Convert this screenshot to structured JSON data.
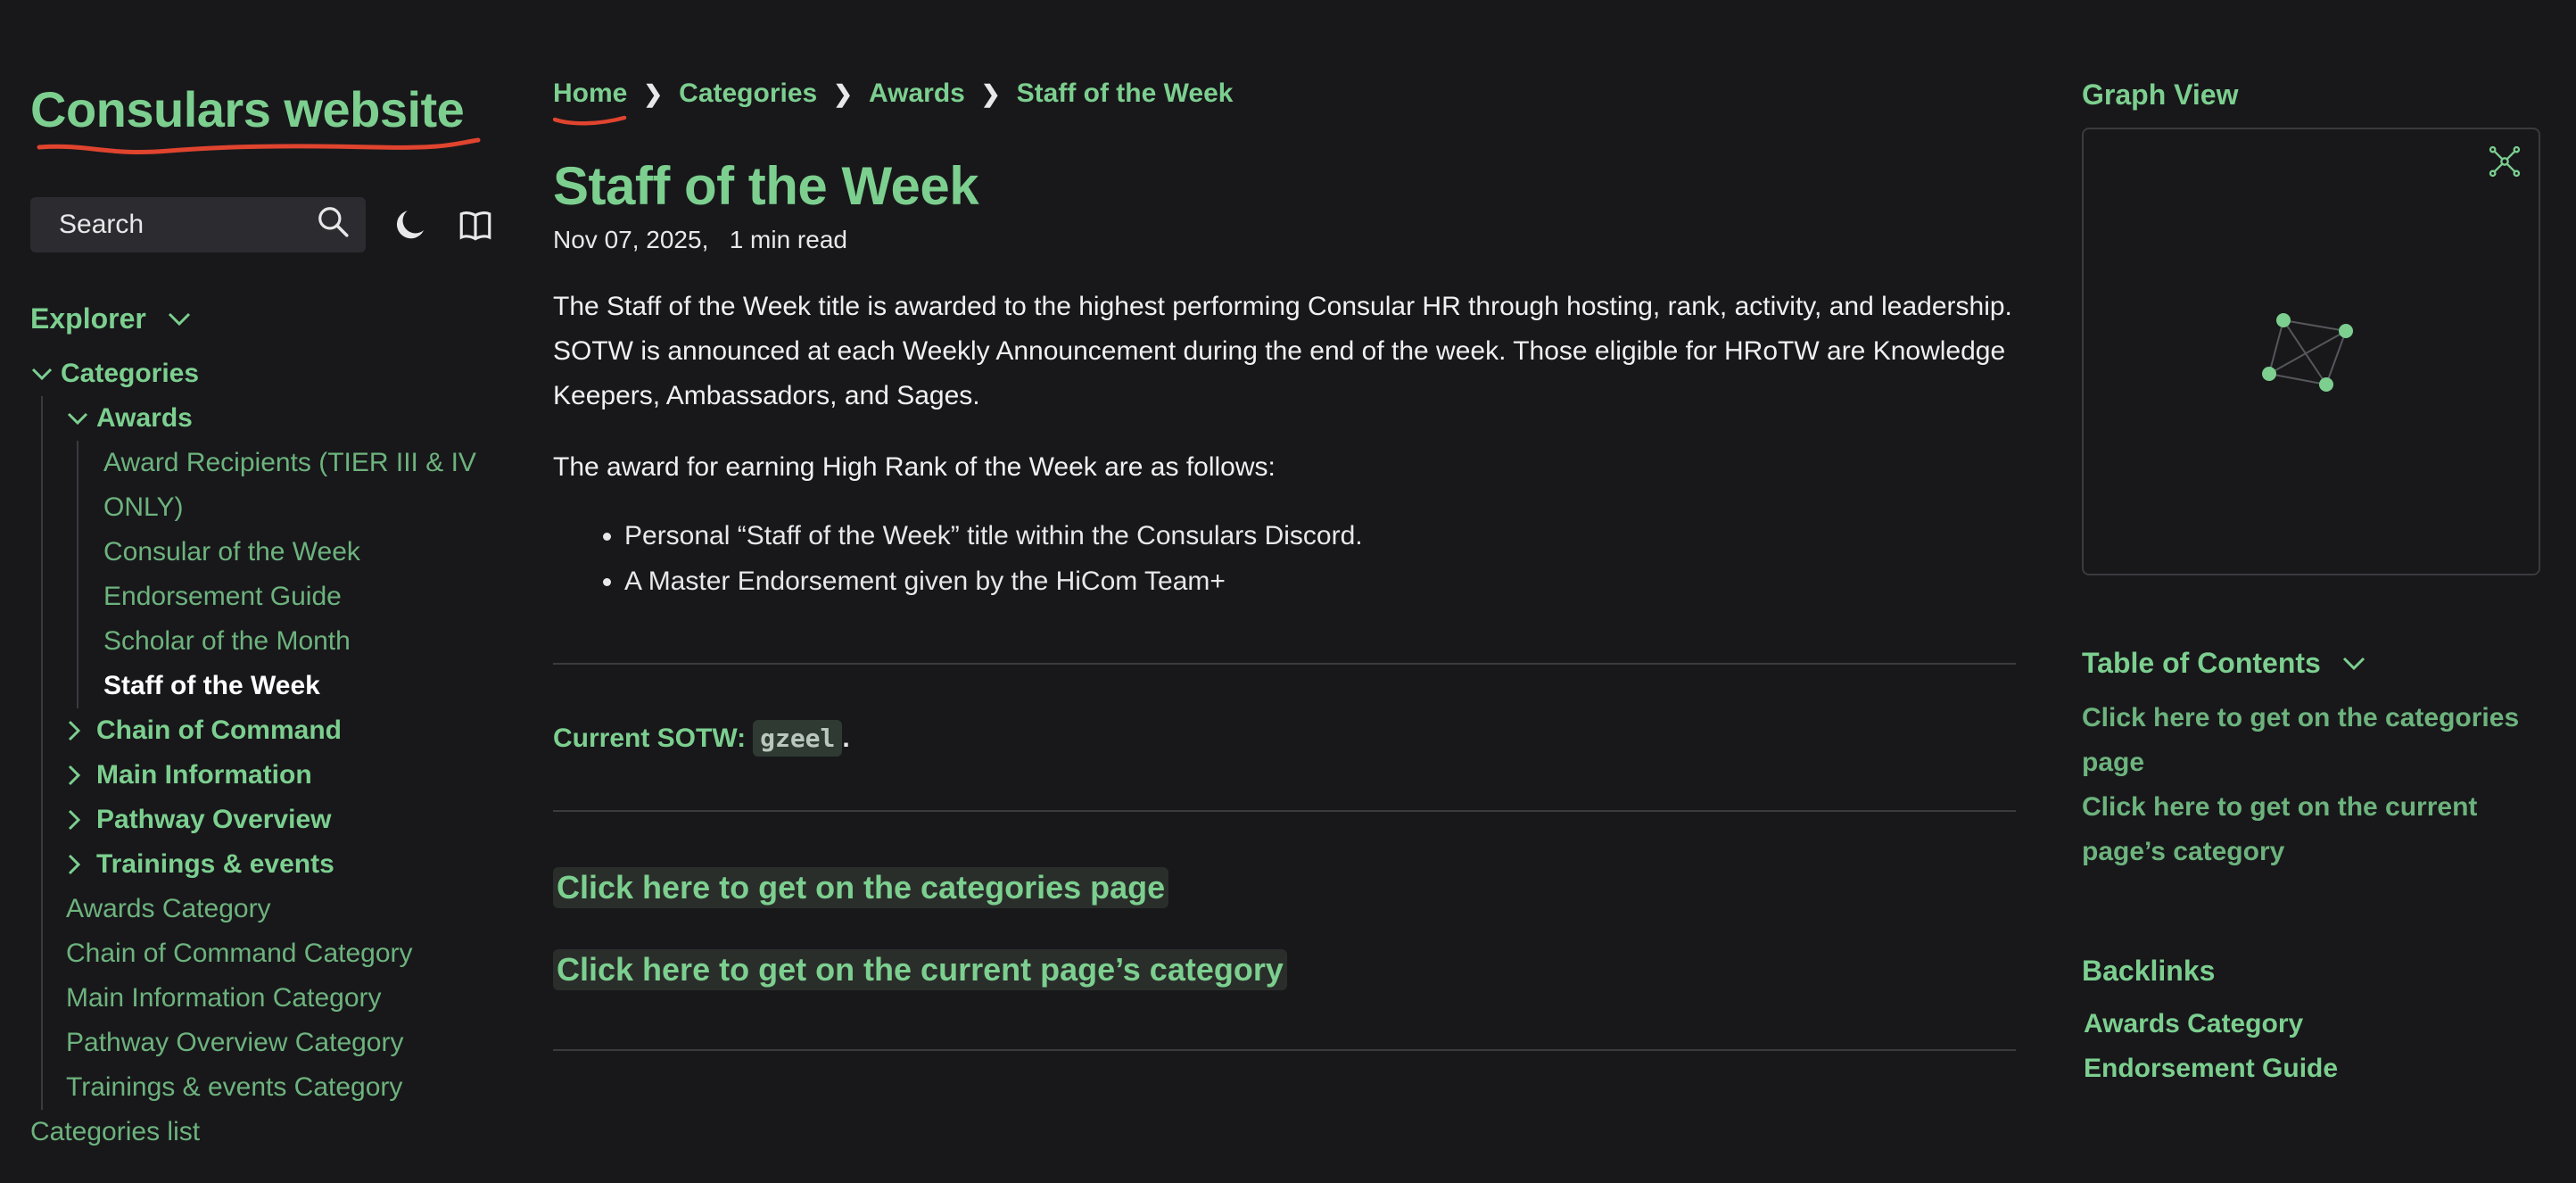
{
  "site": {
    "title": "Consulars website"
  },
  "search": {
    "label": "Search"
  },
  "explorer": {
    "title": "Explorer",
    "tree": {
      "categories": "Categories",
      "awards": "Awards",
      "award_items": [
        "Award Recipients (TIER III & IV",
        "ONLY)",
        "Consular of the Week",
        "Endorsement Guide",
        "Scholar of the Month",
        "Staff of the Week"
      ],
      "folders": [
        "Chain of Command",
        "Main Information",
        "Pathway Overview",
        "Trainings & events"
      ],
      "category_pages": [
        "Awards Category",
        "Chain of Command Category",
        "Main Information Category",
        "Pathway Overview Category",
        "Trainings & events Category"
      ],
      "categories_list": "Categories list"
    }
  },
  "breadcrumb": [
    "Home",
    "Categories",
    "Awards",
    "Staff of the Week"
  ],
  "article": {
    "title": "Staff of the Week",
    "date": "Nov 07, 2025,",
    "read_time": "1 min read",
    "para1_lines": [
      "The Staff of the Week title is awarded to the highest performing Consular HR through hosting, rank, activity, and leadership.",
      "SOTW is announced at each Weekly Announcement during the end of the week. Those eligible for HRoTW are Knowledge",
      "Keepers, Ambassadors, and Sages."
    ],
    "para2": "The award for earning High Rank of the Week are as follows:",
    "bullets": [
      "Personal “Staff of the Week” title within the Consulars Discord.",
      "A Master Endorsement given by the HiCom Team+"
    ],
    "current_label": "Current SOTW:",
    "current_value": "gzeel",
    "current_suffix": ".",
    "link_categories": "Click here to get on the categories page",
    "link_category": "Click here to get on the current page’s category"
  },
  "graph": {
    "title": "Graph View",
    "expand_icon": "expand-graph-icon"
  },
  "toc": {
    "title": "Table of Contents",
    "items": [
      [
        "Click here to get on the categories",
        "page"
      ],
      [
        "Click here to get on the current",
        "page’s category"
      ]
    ]
  },
  "backlinks": {
    "title": "Backlinks",
    "items": [
      "Awards Category",
      "Endorsement Guide"
    ]
  },
  "colors": {
    "accent": "#7ccf8f",
    "background": "#18181b",
    "annotation": "#e0442e"
  }
}
